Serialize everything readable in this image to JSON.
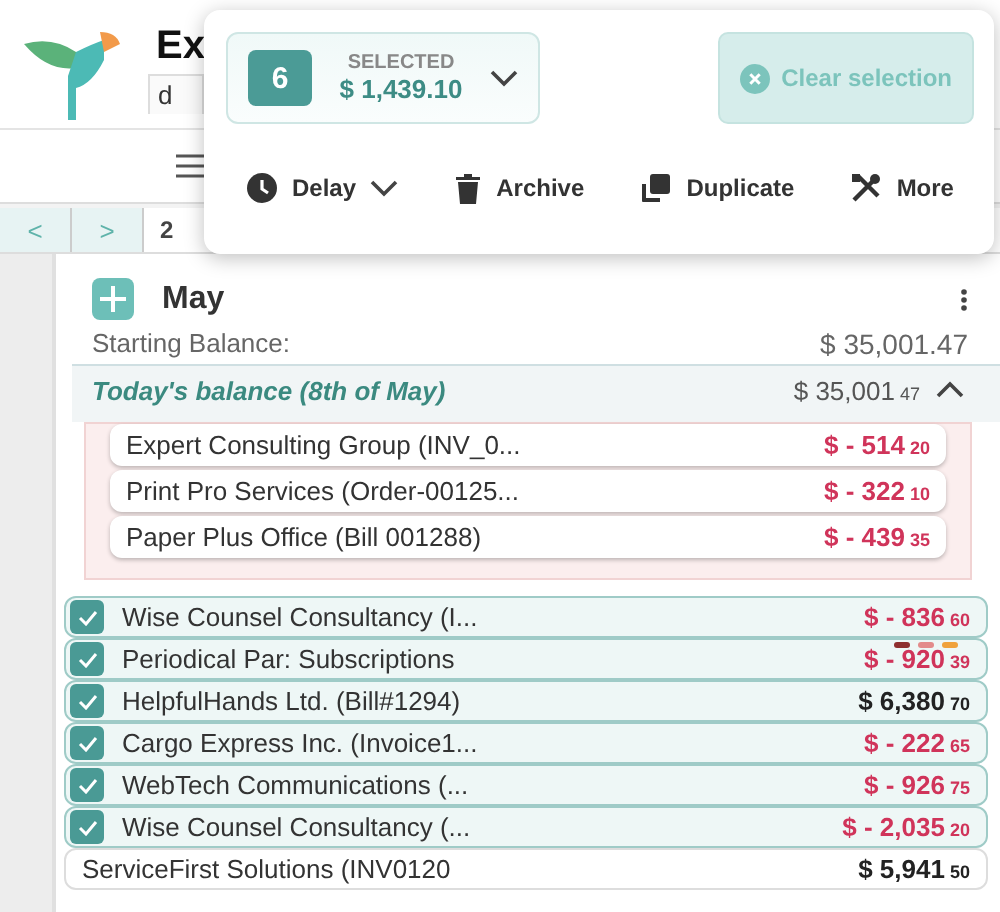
{
  "app": {
    "title": "Ex",
    "tab": "d",
    "date": "2",
    "nav": [
      "<",
      ">"
    ]
  },
  "selection": {
    "count": "6",
    "label": "SELECTED",
    "total": "$ 1,439.10",
    "clear": "Clear selection"
  },
  "actions": [
    {
      "label": "Delay",
      "kind": "dropdown"
    },
    {
      "label": "Archive",
      "kind": "button"
    },
    {
      "label": "Duplicate",
      "kind": "button"
    },
    {
      "label": "More",
      "kind": "button"
    }
  ],
  "month": {
    "name": "May",
    "starting_label": "Starting Balance:",
    "starting_value": "$ 35,001.47",
    "today_label": "Today's balance (8th of May)",
    "today_whole": "$ 35,001",
    "today_cents": "47",
    "expanded": true
  },
  "overdue": [
    {
      "name": "Expert Consulting Group (INV_0...",
      "whole": "$ - 514",
      "cents": "20",
      "negative": true
    },
    {
      "name": "Print Pro Services (Order-00125...",
      "whole": "$ - 322",
      "cents": "10",
      "negative": true
    },
    {
      "name": "Paper Plus Office (Bill 001288)",
      "whole": "$ - 439",
      "cents": "35",
      "negative": true
    }
  ],
  "transactions": [
    {
      "name": "Wise Counsel Consultancy (I...",
      "whole": "$ - 836",
      "cents": "60",
      "negative": true,
      "checked": true
    },
    {
      "name": "Periodical Par: Subscriptions",
      "whole": "$ - 920",
      "cents": "39",
      "negative": true,
      "checked": true,
      "tags": [
        {
          "color": "#8e2f2f"
        },
        {
          "color": "#e38b8b"
        },
        {
          "color": "#f0a23c"
        }
      ]
    },
    {
      "name": "HelpfulHands Ltd. (Bill#1294)",
      "whole": "$ 6,380",
      "cents": "70",
      "negative": false,
      "checked": true
    },
    {
      "name": "Cargo Express Inc. (Invoice1...",
      "whole": "$ - 222",
      "cents": "65",
      "negative": true,
      "checked": true
    },
    {
      "name": "WebTech Communications (...",
      "whole": "$ - 926",
      "cents": "75",
      "negative": true,
      "checked": true
    },
    {
      "name": "Wise Counsel Consultancy (...",
      "whole": "$ - 2,035",
      "cents": "20",
      "negative": true,
      "checked": true
    },
    {
      "name": "ServiceFirst Solutions (INV0120",
      "whole": "$ 5,941",
      "cents": "50",
      "negative": false,
      "checked": false
    }
  ]
}
